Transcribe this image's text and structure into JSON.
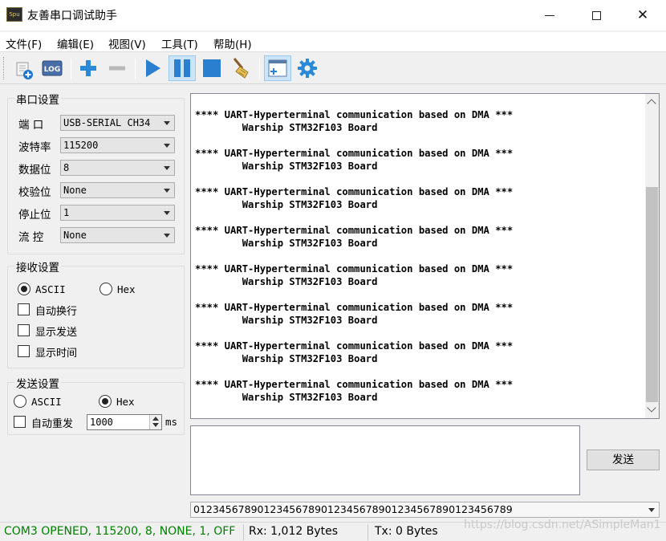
{
  "window": {
    "title": "友善串口调试助手",
    "icon_text": "Spu"
  },
  "menu": [
    "文件(F)",
    "编辑(E)",
    "视图(V)",
    "工具(T)",
    "帮助(H)"
  ],
  "toolbar": {
    "log_label": "LOG",
    "buttons": [
      "new-session-icon",
      "log-icon",
      "add-icon",
      "remove-icon",
      "play-icon",
      "pause-icon",
      "stop-icon",
      "clear-broom-icon",
      "add-window-icon",
      "settings-gear-icon"
    ],
    "active_button": "pause-icon"
  },
  "serial_settings": {
    "title": "串口设置",
    "rows": [
      {
        "label": "端  口",
        "value": "USB-SERIAL CH34"
      },
      {
        "label": "波特率",
        "value": "115200"
      },
      {
        "label": "数据位",
        "value": "8"
      },
      {
        "label": "校验位",
        "value": "None"
      },
      {
        "label": "停止位",
        "value": "1"
      },
      {
        "label": "流  控",
        "value": "None"
      }
    ]
  },
  "receive_settings": {
    "title": "接收设置",
    "ascii_label": "ASCII",
    "hex_label": "Hex",
    "selected": "ASCII",
    "auto_wrap": "自动换行",
    "show_send": "显示发送",
    "show_time": "显示时间"
  },
  "send_settings": {
    "title": "发送设置",
    "ascii_label": "ASCII",
    "hex_label": "Hex",
    "selected": "Hex",
    "auto_resend": "自动重发",
    "interval": "1000",
    "unit": "ms"
  },
  "receive_area": {
    "lines": [
      "**** UART-Hyperterminal communication based on DMA ***",
      "        Warship STM32F103 Board",
      "",
      "**** UART-Hyperterminal communication based on DMA ***",
      "        Warship STM32F103 Board",
      "",
      "**** UART-Hyperterminal communication based on DMA ***",
      "        Warship STM32F103 Board",
      "",
      "**** UART-Hyperterminal communication based on DMA ***",
      "        Warship STM32F103 Board",
      "",
      "**** UART-Hyperterminal communication based on DMA ***",
      "        Warship STM32F103 Board",
      "",
      "**** UART-Hyperterminal communication based on DMA ***",
      "        Warship STM32F103 Board",
      "",
      "**** UART-Hyperterminal communication based on DMA ***",
      "        Warship STM32F103 Board",
      "",
      "**** UART-Hyperterminal communication based on DMA ***",
      "        Warship STM32F103 Board"
    ]
  },
  "send_area": {
    "button_label": "发送",
    "history_value": "01234567890123456789012345678901234567890123456789"
  },
  "status": {
    "connection": "COM3 OPENED, 115200, 8, NONE, 1, OFF",
    "connection_color": "#008000",
    "rx": "Rx: 1,012 Bytes",
    "tx": "Tx: 0 Bytes",
    "watermark": "https://blog.csdn.net/ASimpleMan1"
  }
}
